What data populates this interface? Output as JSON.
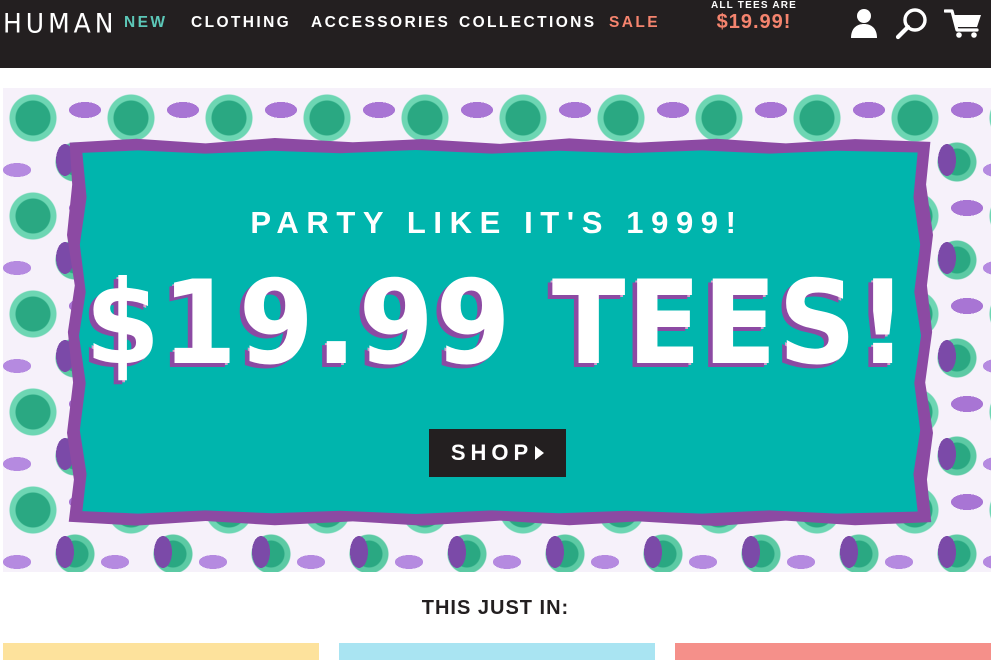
{
  "header": {
    "logo": "HUMAN",
    "nav": [
      {
        "label": "NEW",
        "color": "#5cc7b8"
      },
      {
        "label": "CLOTHING",
        "color": "#ffffff"
      },
      {
        "label": "ACCESSORIES",
        "color": "#ffffff"
      },
      {
        "label": "COLLECTIONS",
        "color": "#ffffff"
      },
      {
        "label": "SALE",
        "color": "#f5846e"
      }
    ],
    "promo": {
      "line1": "ALL TEES ARE",
      "price": "$19.99!",
      "price_color": "#f5846e"
    },
    "icons": [
      "account-icon",
      "search-icon",
      "cart-icon"
    ]
  },
  "hero": {
    "subtitle": "PARTY LIKE IT'S 1999!",
    "title": "$19.99 TEES!",
    "cta": "SHOP",
    "colors": {
      "panel": "#00b5ad",
      "frame": "#8c4aa3",
      "title_shadow": "#8c4aa3"
    }
  },
  "section": {
    "title": "THIS JUST IN:"
  },
  "product_cards": [
    {
      "color": "#fde29c"
    },
    {
      "color": "#a9e4f2"
    },
    {
      "color": "#f5908a"
    }
  ]
}
